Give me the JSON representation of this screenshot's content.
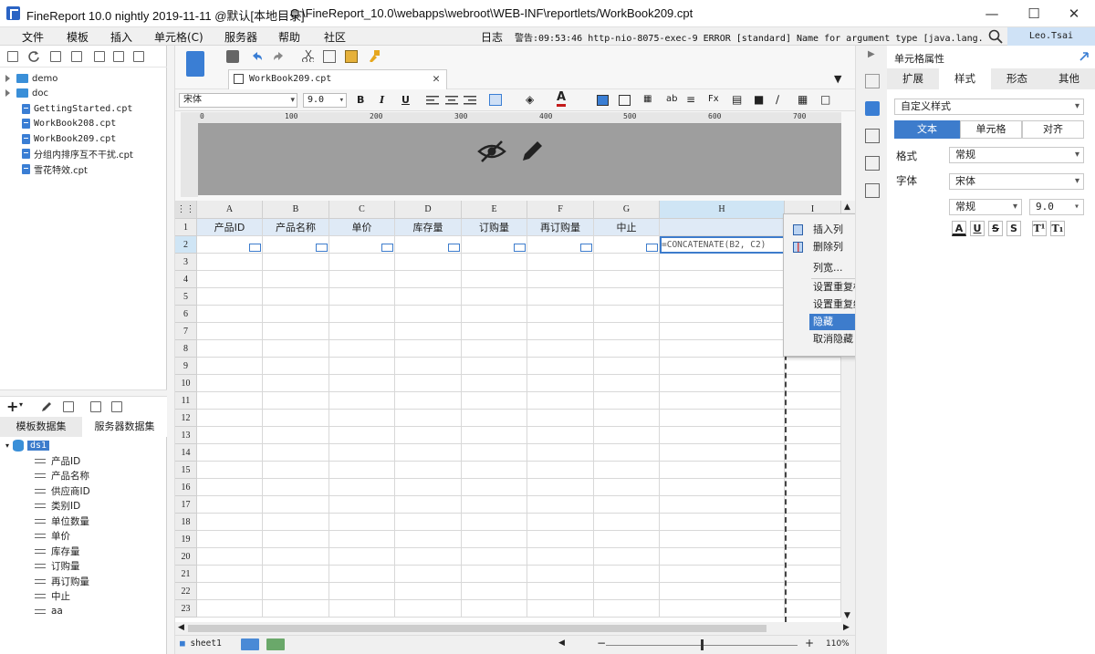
{
  "window": {
    "title": "FineReport 10.0 nightly 2019-11-11 @默认[本地目录]",
    "path": "C:\\FineReport_10.0\\webapps\\webroot\\WEB-INF\\reportlets/WorkBook209.cpt"
  },
  "menubar": {
    "items": [
      "文件",
      "模板",
      "插入",
      "单元格(C)",
      "服务器",
      "帮助",
      "社区"
    ],
    "log_label": "日志",
    "log_text": "警告:09:53:46 http-nio-8075-exec-9 ERROR [standard] Name for argument type [java.lang.Stri...",
    "user": "Leo.Tsai"
  },
  "file_tree": {
    "items": [
      {
        "label": "demo",
        "type": "folder"
      },
      {
        "label": "doc",
        "type": "folder"
      },
      {
        "label": "GettingStarted.cpt",
        "type": "file"
      },
      {
        "label": "WorkBook208.cpt",
        "type": "file"
      },
      {
        "label": "WorkBook209.cpt",
        "type": "file"
      },
      {
        "label": "分组内排序互不干扰.cpt",
        "type": "file"
      },
      {
        "label": "雪花特效.cpt",
        "type": "file"
      }
    ]
  },
  "dataset": {
    "tabs": [
      "模板数据集",
      "服务器数据集"
    ],
    "name": "ds1",
    "fields": [
      "产品ID",
      "产品名称",
      "供应商ID",
      "类别ID",
      "单位数量",
      "单价",
      "库存量",
      "订购量",
      "再订购量",
      "中止",
      "aa"
    ]
  },
  "editor": {
    "tab_name": "WorkBook209.cpt",
    "font_name": "宋体",
    "font_size": "9.0",
    "ruler_ticks": [
      "0",
      "100",
      "200",
      "300",
      "400",
      "500",
      "600",
      "700"
    ],
    "columns": [
      "A",
      "B",
      "C",
      "D",
      "E",
      "F",
      "G",
      "H",
      "I"
    ],
    "rows": [
      "1",
      "2",
      "3",
      "4",
      "5",
      "6",
      "7",
      "8",
      "9",
      "10",
      "11",
      "12",
      "13",
      "14",
      "15",
      "16",
      "17",
      "18",
      "19",
      "20",
      "21",
      "22",
      "23"
    ],
    "header_row": [
      "产品ID",
      "产品名称",
      "单价",
      "库存量",
      "订购量",
      "再订购量",
      "中止"
    ],
    "formula": "=CONCATENATE(B2, C2)",
    "sheet_name": "sheet1",
    "zoom": "110%",
    "zoom_minus": "−",
    "zoom_plus": "+"
  },
  "context_menu": {
    "items": [
      "插入列",
      "删除列",
      "列宽...",
      "设置重复标题列",
      "设置重复结尾列",
      "隐藏",
      "取消隐藏"
    ],
    "highlighted": "隐藏"
  },
  "properties": {
    "title": "单元格属性",
    "tabs": [
      "扩展",
      "样式",
      "形态",
      "其他"
    ],
    "active_tab": "样式",
    "style_select": "自定义样式",
    "segments": [
      "文本",
      "单元格",
      "对齐"
    ],
    "format_label": "格式",
    "format_value": "常规",
    "font_label": "字体",
    "font_value": "宋体",
    "font_style": "常规",
    "font_size": "9.0",
    "style_buttons": [
      "A",
      "U",
      "S",
      "S",
      "T¹",
      "T₁"
    ]
  },
  "colors": {
    "accent": "#3d7ccc",
    "selected_header": "#cfe5f5",
    "header_cell": "#dfeaf6"
  }
}
